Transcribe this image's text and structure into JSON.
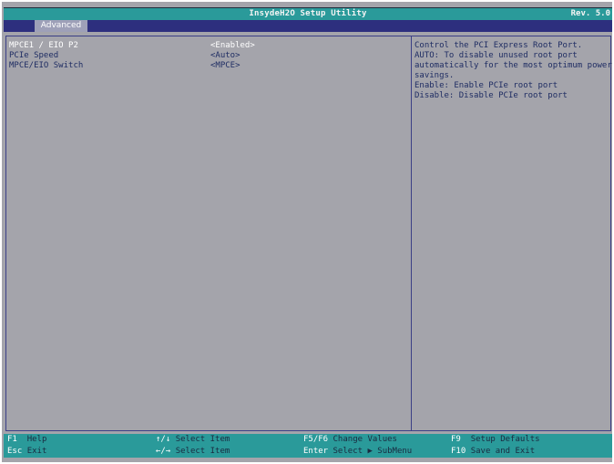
{
  "header": {
    "title": "InsydeH2O Setup Utility",
    "revision": "Rev. 5.0",
    "active_tab": "Advanced"
  },
  "settings": [
    {
      "label": "MPCE1 / EIO P2",
      "value": "<Enabled>",
      "selected": true
    },
    {
      "label": "PCIe Speed",
      "value": "<Auto>",
      "selected": false
    },
    {
      "label": "MPCE/EIO Switch",
      "value": "<MPCE>",
      "selected": false
    }
  ],
  "help": {
    "lines": [
      "Control the PCI Express Root Port.",
      "AUTO: To disable unused root port",
      "automatically for the most optimum power",
      "savings.",
      "Enable: Enable PCIe root port",
      "Disable: Disable PCIe root port"
    ]
  },
  "footer": {
    "keys": [
      {
        "key": "F1",
        "desc": "Help"
      },
      {
        "key": "Esc",
        "desc": "Exit"
      },
      {
        "key": "↑/↓",
        "desc": "Select Item"
      },
      {
        "key": "←/→",
        "desc": "Select Item"
      },
      {
        "key": "F5/F6",
        "desc": "Change Values"
      },
      {
        "key": "Enter",
        "desc": "Select ▶ SubMenu"
      },
      {
        "key": "F9",
        "desc": "Setup Defaults"
      },
      {
        "key": "F10",
        "desc": "Save and Exit"
      }
    ]
  },
  "colors": {
    "title_bar": "#2a9a9a",
    "tab_bar": "#2d2f7e",
    "background": "#a4a4ab",
    "text": "#1f2d63",
    "highlight": "#ffffff"
  }
}
